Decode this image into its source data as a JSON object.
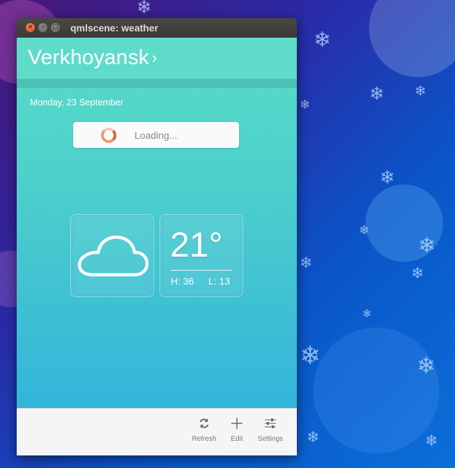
{
  "window": {
    "title": "qmlscene: weather",
    "buttons": {
      "close": "×",
      "minimize": "–",
      "maximize": "□"
    }
  },
  "header": {
    "city": "Verkhoyansk",
    "chevron": "›"
  },
  "date": "Monday, 23 September",
  "loading": {
    "text": "Loading..."
  },
  "weather": {
    "icon": "cloud-icon",
    "temperature": "21°",
    "high": "H: 36",
    "low": "L: 13"
  },
  "toolbar": {
    "refresh": {
      "label": "Refresh",
      "icon": "refresh-icon"
    },
    "edit": {
      "label": "Edit",
      "icon": "plus-icon"
    },
    "settings": {
      "label": "Settings",
      "icon": "sliders-icon"
    }
  },
  "colors": {
    "header": "#5fdcc9",
    "accent_orange": "#e0521d",
    "toolbar": "#f5f5f5"
  }
}
